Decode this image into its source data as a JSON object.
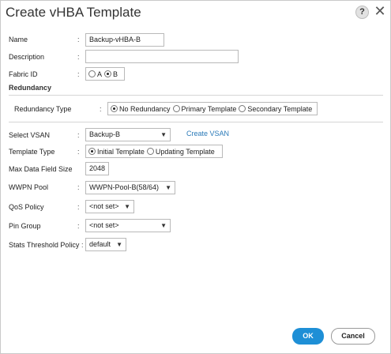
{
  "dialog": {
    "title": "Create vHBA Template",
    "help_icon": "?",
    "close_icon": "✕"
  },
  "form": {
    "name": {
      "label": "Name",
      "value": "Backup-vHBA-B"
    },
    "description": {
      "label": "Description",
      "value": ""
    },
    "fabric_id": {
      "label": "Fabric ID",
      "options": [
        "A",
        "B"
      ],
      "selected": "B"
    },
    "redundancy_section": "Redundancy",
    "redundancy_type": {
      "label": "Redundancy Type",
      "options": [
        "No Redundancy",
        "Primary Template",
        "Secondary Template"
      ],
      "selected": "No Redundancy"
    },
    "select_vsan": {
      "label": "Select VSAN",
      "value": "Backup-B",
      "link": "Create VSAN"
    },
    "template_type": {
      "label": "Template Type",
      "options": [
        "Initial Template",
        "Updating Template"
      ],
      "selected": "Initial Template"
    },
    "max_data_field_size": {
      "label": "Max Data Field Size",
      "value": "2048"
    },
    "wwpn_pool": {
      "label": "WWPN Pool",
      "value": "WWPN-Pool-B(58/64)"
    },
    "qos_policy": {
      "label": "QoS Policy",
      "value": "<not set>"
    },
    "pin_group": {
      "label": "Pin Group",
      "value": "<not set>"
    },
    "stats_threshold_policy": {
      "label": "Stats Threshold Policy",
      "value": "default"
    }
  },
  "colon": ":",
  "caret": "▼",
  "buttons": {
    "ok": "OK",
    "cancel": "Cancel"
  },
  "colors": {
    "primary_button": "#1e8fd6",
    "link": "#2a7ab8"
  }
}
